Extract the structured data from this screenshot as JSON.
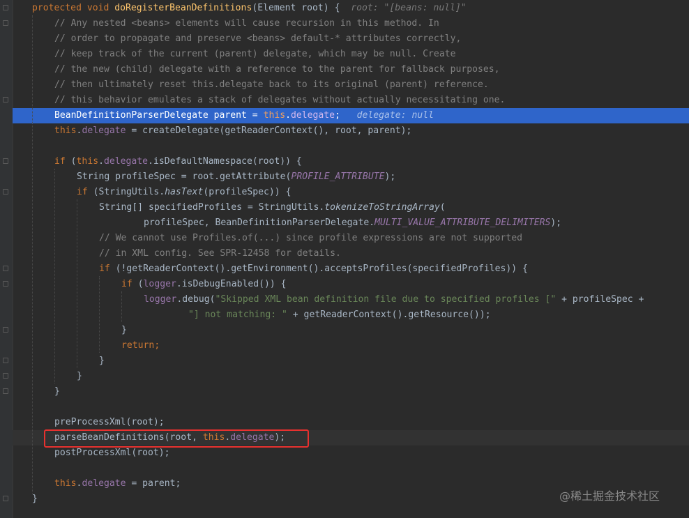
{
  "editor": {
    "lines": [
      {
        "parts": [
          {
            "t": "protected void ",
            "c": "kw"
          },
          {
            "t": "doRegisterBeanDefinitions",
            "c": "fn"
          },
          {
            "t": "(Element root) {  "
          },
          {
            "t": "root: \"[beans: null]\"",
            "c": "hint"
          }
        ]
      },
      {
        "parts": [
          {
            "t": "// Any nested <beans> elements will cause recursion in this method. In",
            "c": "cm"
          }
        ]
      },
      {
        "parts": [
          {
            "t": "// order to propagate and preserve <beans> default-* attributes correctly,",
            "c": "cm"
          }
        ]
      },
      {
        "parts": [
          {
            "t": "// keep track of the current (parent) delegate, which may be null. Create",
            "c": "cm"
          }
        ]
      },
      {
        "parts": [
          {
            "t": "// the new (child) delegate with a reference to the parent for fallback purposes,",
            "c": "cm"
          }
        ]
      },
      {
        "parts": [
          {
            "t": "// then ultimately reset this.delegate back to its original (parent) reference.",
            "c": "cm"
          }
        ]
      },
      {
        "parts": [
          {
            "t": "// this behavior emulates a stack of delegates without actually necessitating one.",
            "c": "cm"
          }
        ]
      },
      {
        "parts": [
          {
            "t": "BeanDefinitionParserDelegate parent = "
          },
          {
            "t": "this",
            "c": "kw"
          },
          {
            "t": "."
          },
          {
            "t": "delegate",
            "c": "fld"
          },
          {
            "t": ";   "
          },
          {
            "t": "delegate: null",
            "c": "hint-sel"
          }
        ]
      },
      {
        "parts": [
          {
            "t": "this",
            "c": "kw"
          },
          {
            "t": "."
          },
          {
            "t": "delegate",
            "c": "fld"
          },
          {
            "t": " = createDelegate(getReaderContext(), root, parent);"
          }
        ]
      },
      {
        "parts": []
      },
      {
        "parts": [
          {
            "t": "if ",
            "c": "kw"
          },
          {
            "t": "("
          },
          {
            "t": "this",
            "c": "kw"
          },
          {
            "t": "."
          },
          {
            "t": "delegate",
            "c": "fld"
          },
          {
            "t": ".isDefaultNamespace(root)) {"
          }
        ]
      },
      {
        "parts": [
          {
            "t": "String profileSpec = root.getAttribute("
          },
          {
            "t": "PROFILE_ATTRIBUTE",
            "c": "cst"
          },
          {
            "t": ");"
          }
        ]
      },
      {
        "parts": [
          {
            "t": "if ",
            "c": "kw"
          },
          {
            "t": "(StringUtils."
          },
          {
            "t": "hasText",
            "c": "ital"
          },
          {
            "t": "(profileSpec)) {"
          }
        ]
      },
      {
        "parts": [
          {
            "t": "String[] specifiedProfiles = StringUtils."
          },
          {
            "t": "tokenizeToStringArray",
            "c": "ital"
          },
          {
            "t": "("
          }
        ]
      },
      {
        "parts": [
          {
            "t": "profileSpec, BeanDefinitionParserDelegate."
          },
          {
            "t": "MULTI_VALUE_ATTRIBUTE_DELIMITERS",
            "c": "cst"
          },
          {
            "t": ");"
          }
        ]
      },
      {
        "parts": [
          {
            "t": "// We cannot use Profiles.of(...) since profile expressions are not supported",
            "c": "cm"
          }
        ]
      },
      {
        "parts": [
          {
            "t": "// in XML config. See SPR-12458 for details.",
            "c": "cm"
          }
        ]
      },
      {
        "parts": [
          {
            "t": "if ",
            "c": "kw"
          },
          {
            "t": "(!getReaderContext().getEnvironment().acceptsProfiles(specifiedProfiles)) {"
          }
        ]
      },
      {
        "parts": [
          {
            "t": "if ",
            "c": "kw"
          },
          {
            "t": "("
          },
          {
            "t": "logger",
            "c": "fld"
          },
          {
            "t": ".isDebugEnabled()) {"
          }
        ]
      },
      {
        "parts": [
          {
            "t": "logger",
            "c": "fld"
          },
          {
            "t": ".debug("
          },
          {
            "t": "\"Skipped XML bean definition file due to specified profiles [\"",
            "c": "str"
          },
          {
            "t": " + profileSpec +"
          }
        ]
      },
      {
        "parts": [
          {
            "t": "\"] not matching: \"",
            "c": "str"
          },
          {
            "t": " + getReaderContext().getResource());"
          }
        ]
      },
      {
        "parts": [
          {
            "t": "}"
          }
        ]
      },
      {
        "parts": [
          {
            "t": "return",
            "c": "kw"
          },
          {
            "t": ";",
            "c": "kw"
          }
        ]
      },
      {
        "parts": [
          {
            "t": "}"
          }
        ]
      },
      {
        "parts": [
          {
            "t": "}"
          }
        ]
      },
      {
        "parts": [
          {
            "t": "}"
          }
        ]
      },
      {
        "parts": []
      },
      {
        "parts": [
          {
            "t": "preProcessXml(root);"
          }
        ]
      },
      {
        "parts": [
          {
            "t": "parseBeanDefinitions(root, "
          },
          {
            "t": "this",
            "c": "kw"
          },
          {
            "t": "."
          },
          {
            "t": "delegate",
            "c": "fld"
          },
          {
            "t": ");"
          }
        ]
      },
      {
        "parts": [
          {
            "t": "postProcessXml(root);"
          }
        ]
      },
      {
        "parts": []
      },
      {
        "parts": [
          {
            "t": "this",
            "c": "kw"
          },
          {
            "t": "."
          },
          {
            "t": "delegate",
            "c": "fld"
          },
          {
            "t": " = parent;"
          }
        ]
      },
      {
        "parts": [
          {
            "t": "}"
          }
        ]
      }
    ]
  },
  "watermark": "@稀土掘金技术社区",
  "colors": {
    "background": "#2b2b2b",
    "keyword": "#cc7832",
    "method": "#ffc66d",
    "comment": "#808080",
    "string": "#6a8759",
    "field": "#9876aa",
    "current_line": "#2f65ca",
    "highlight_box": "#e8312f"
  }
}
